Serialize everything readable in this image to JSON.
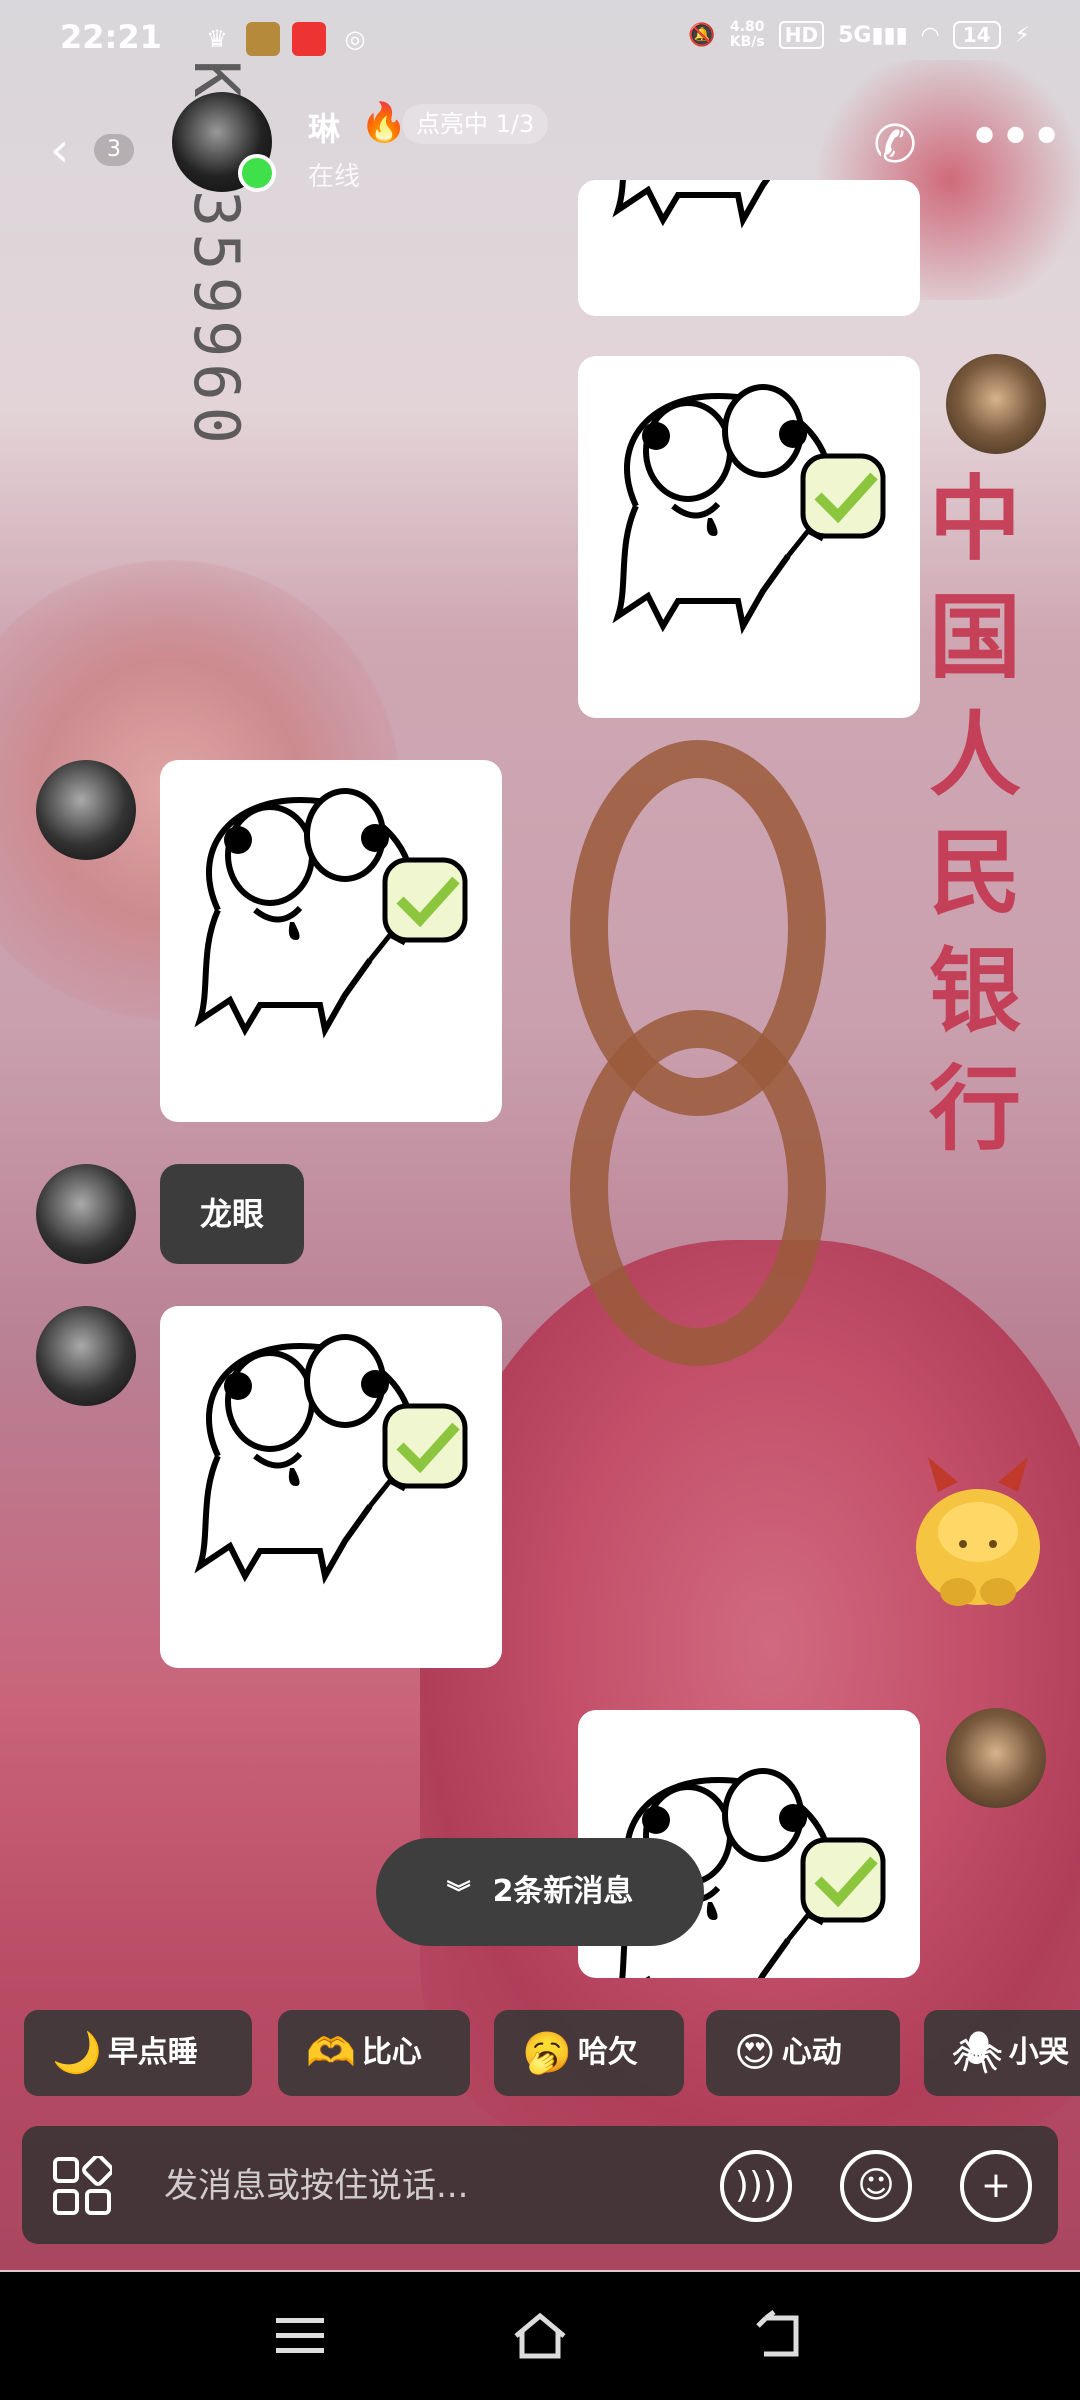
{
  "status_bar": {
    "time": "22:21",
    "net_rate_top": "4.80",
    "net_rate_bottom": "KB/s",
    "hd": "HD",
    "signal": "5G",
    "battery": "14"
  },
  "header": {
    "back_badge": "3",
    "contact_name": "琳",
    "lit_label": "点亮中 1/3",
    "presence": "在线",
    "online_color": "#3fe04a"
  },
  "messages": [
    {
      "sender": "me",
      "type": "sticker"
    },
    {
      "sender": "me",
      "type": "sticker"
    },
    {
      "sender": "other",
      "type": "sticker"
    },
    {
      "sender": "other",
      "type": "text",
      "text": "龙眼"
    },
    {
      "sender": "other",
      "type": "sticker"
    },
    {
      "sender": "me",
      "type": "sticker"
    }
  ],
  "new_messages_pill": "2条新消息",
  "quick_replies": [
    {
      "icon": "moon-emoji-icon",
      "label": "早点睡"
    },
    {
      "icon": "heart-hands-emoji-icon",
      "label": "比心"
    },
    {
      "icon": "yawn-emoji-icon",
      "label": "哈欠"
    },
    {
      "icon": "heart-eyes-emoji-icon",
      "label": "心动"
    },
    {
      "icon": "spiderman-emoji-icon",
      "label": "小哭"
    }
  ],
  "input": {
    "placeholder": "发消息或按住说话..."
  },
  "icons": {
    "grid": "apps-grid-icon",
    "voice": "voice-icon",
    "emoji": "emoji-icon",
    "plus": "plus-icon",
    "call": "phone-icon",
    "more": "more-icon"
  }
}
